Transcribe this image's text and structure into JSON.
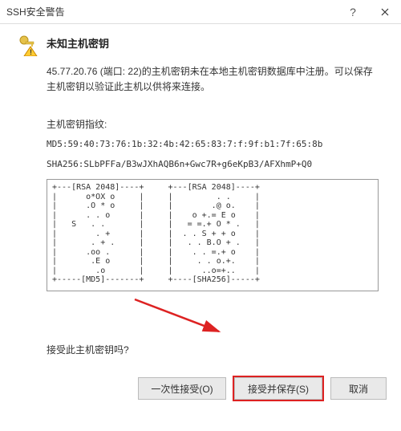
{
  "titlebar": {
    "title": "SSH安全警告"
  },
  "dialog": {
    "heading": "未知主机密钥",
    "body": "45.77.20.76 (端口: 22)的主机密钥未在本地主机密钥数据库中注册。可以保存主机密钥以验证此主机以供将来连接。",
    "fingerprint_label": "主机密钥指纹:",
    "md5": "MD5:59:40:73:76:1b:32:4b:42:65:83:7:f:9f:b1:7f:65:8b",
    "sha256": "SHA256:SLbPFFa/B3wJXhAQB6n+Gwc7R+g6eKpB3/AFXhmP+Q0",
    "ascii_art": "+---[RSA 2048]----+     +---[RSA 2048]----+\n|      o*OX o     |     |         . .     |\n|      .O * o     |     |        .@ o.    |\n|      . . o      |     |    o +.= E o    |\n|   S   . .       |     |   = =.+ O * .   |\n|        . +      |     |  . . S + + o    |\n|       . + .     |     |   . . B.O + .   |\n|      .oo .      |     |    . . =.+ o    |\n|       .E o      |     |     . . o.+.    |\n|        .o       |     |      ..o=+..    |\n+-----[MD5]-------+     +----[SHA256]-----+",
    "question": "接受此主机密钥吗?"
  },
  "buttons": {
    "accept_once": "一次性接受(O)",
    "accept_save": "接受并保存(S)",
    "cancel": "取消"
  }
}
